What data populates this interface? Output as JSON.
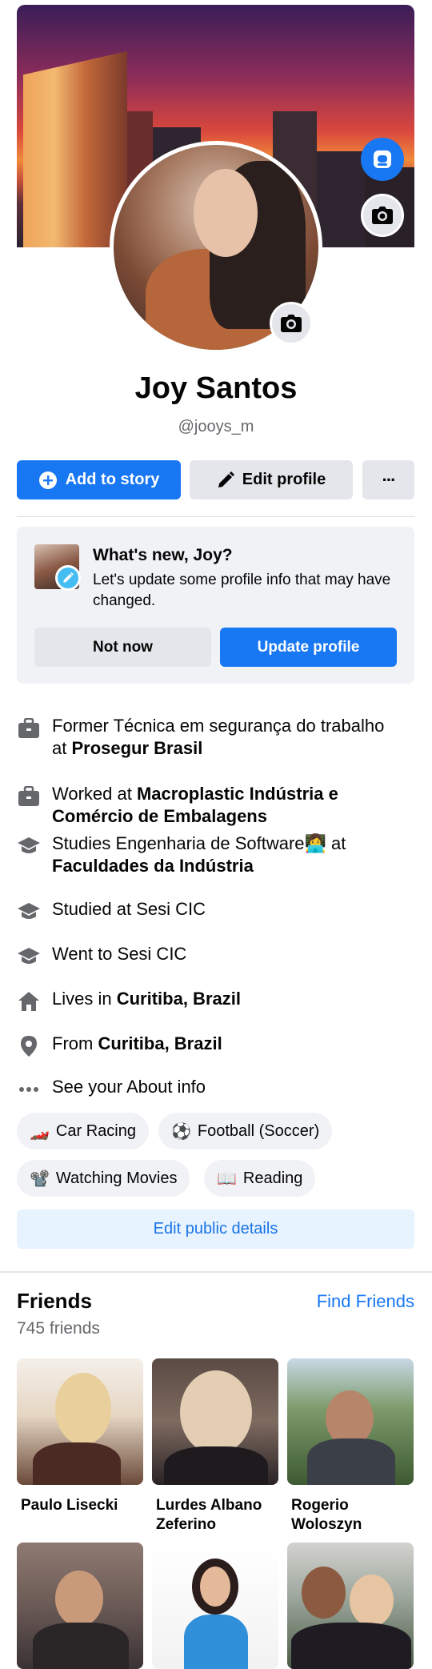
{
  "profile": {
    "name": "Joy Santos",
    "handle": "@jooys_m"
  },
  "actions": {
    "add_story": "Add to story",
    "edit_profile": "Edit profile",
    "more": "···"
  },
  "prompt_card": {
    "title": "What's new, Joy?",
    "description": "Let's update some profile info that may have changed.",
    "not_now": "Not now",
    "update": "Update profile"
  },
  "info_items": [
    {
      "icon": "briefcase-icon",
      "prefix": "Former Técnica em segurança do trabalho at ",
      "bold": "Prosegur Brasil"
    },
    {
      "icon": "briefcase-icon",
      "prefix": "Worked at ",
      "bold": "Macroplastic Indústria e Comércio de Embalagens"
    },
    {
      "icon": "graduation-cap-icon",
      "prefix": "Studies Engenharia de Software👩‍💻 at ",
      "bold": "Faculdades da Indústria"
    },
    {
      "icon": "graduation-cap-icon",
      "prefix": "Studied at Sesi CIC",
      "bold": ""
    },
    {
      "icon": "graduation-cap-icon",
      "prefix": "Went to Sesi CIC",
      "bold": ""
    },
    {
      "icon": "home-icon",
      "prefix": "Lives in ",
      "bold": "Curitiba, Brazil"
    },
    {
      "icon": "location-pin-icon",
      "prefix": "From ",
      "bold": "Curitiba, Brazil"
    },
    {
      "icon": "more-dots-icon",
      "prefix": "See your About info",
      "bold": ""
    }
  ],
  "hobbies": [
    {
      "emoji": "🏎️",
      "label": "Car Racing"
    },
    {
      "emoji": "⚽",
      "label": "Football (Soccer)"
    },
    {
      "emoji": "📽️",
      "label": "Watching Movies"
    },
    {
      "emoji": "📖",
      "label": "Reading"
    }
  ],
  "edit_public": "Edit public details",
  "friends": {
    "title": "Friends",
    "count": "745 friends",
    "find": "Find Friends",
    "list": [
      {
        "name": "Paulo Lisecki"
      },
      {
        "name": "Lurdes Albano Zeferino"
      },
      {
        "name": "Rogerio Woloszyn"
      },
      {
        "name": ""
      },
      {
        "name": ""
      },
      {
        "name": ""
      }
    ]
  },
  "colors": {
    "accent": "#1877f2",
    "secondary_button": "#e4e6eb",
    "muted_text": "#65676b"
  }
}
